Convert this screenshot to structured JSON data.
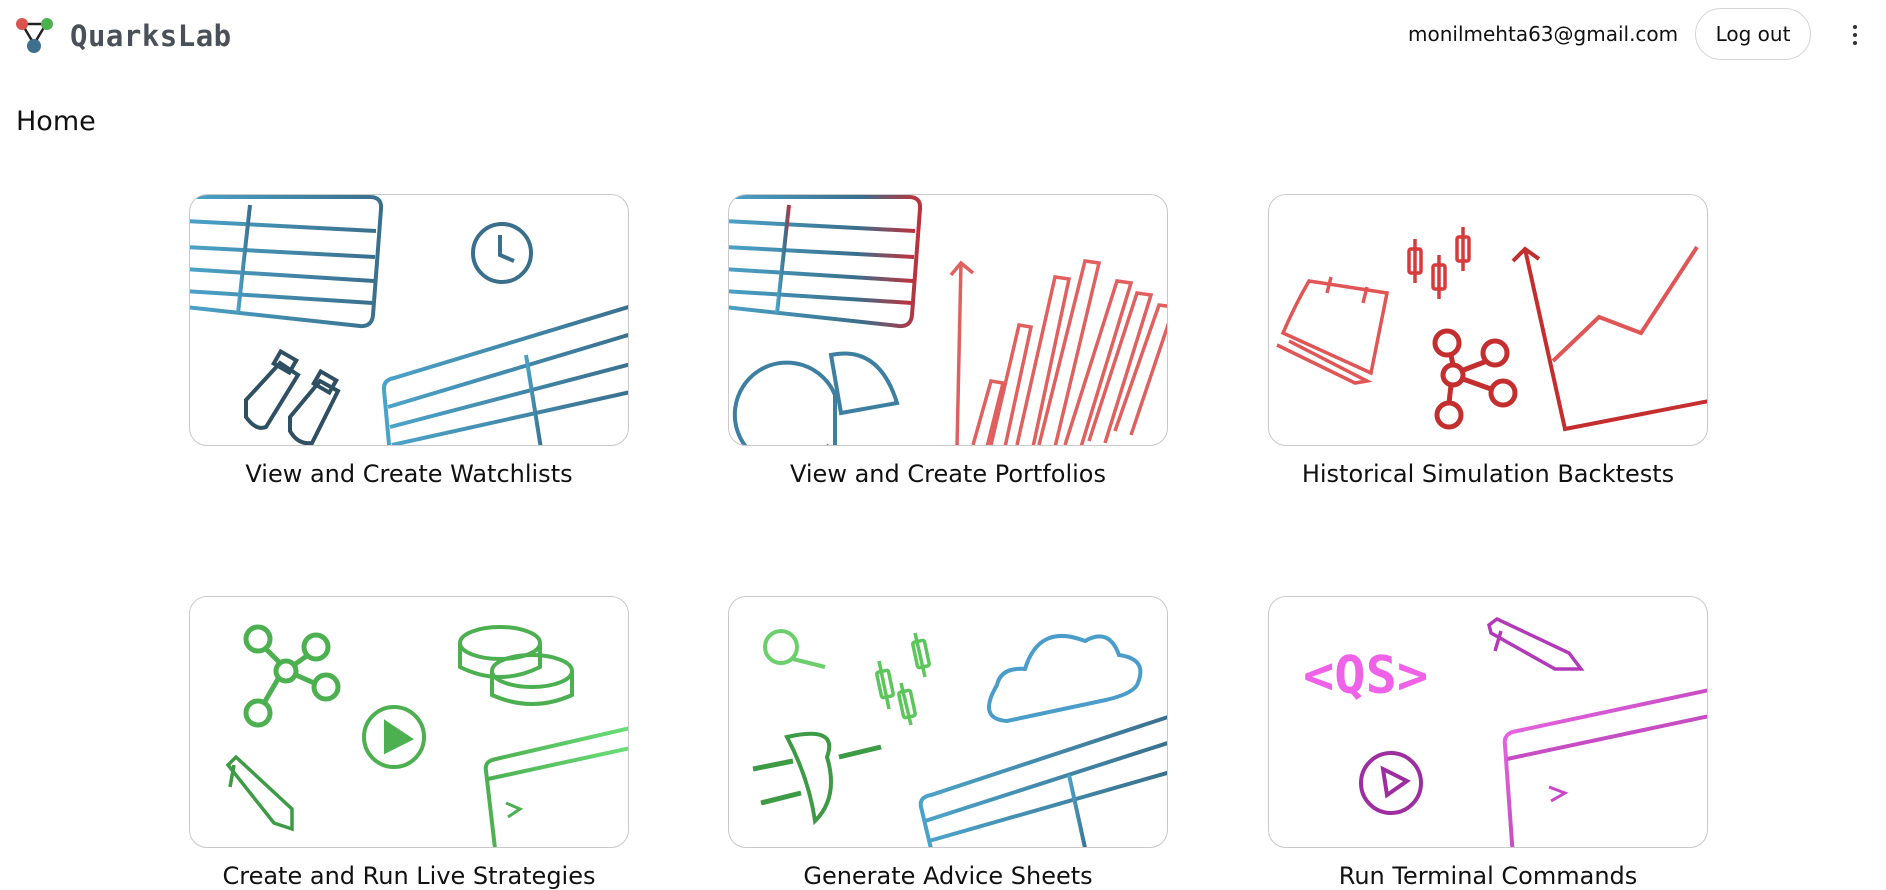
{
  "header": {
    "logo_text": "QuarksLab",
    "user_email": "monilmehta63@gmail.com",
    "logout_label": "Log out"
  },
  "page": {
    "title": "Home"
  },
  "cards": [
    {
      "label": "View and Create Watchlists",
      "icons": [
        "table-icon",
        "clock-icon",
        "binoculars-icon",
        "table-icon"
      ],
      "accent": "#3d7fa0"
    },
    {
      "label": "View and Create Portfolios",
      "icons": [
        "table-icon",
        "pie-chart-icon",
        "bar-chart-icon"
      ],
      "accent": "#d9534f"
    },
    {
      "label": "Historical Simulation Backtests",
      "icons": [
        "calendar-icon",
        "candlestick-icon",
        "network-icon",
        "line-chart-icon"
      ],
      "accent": "#d63a3a"
    },
    {
      "label": "Create and Run Live Strategies",
      "icons": [
        "network-icon",
        "coins-icon",
        "play-icon",
        "pen-icon",
        "terminal-window-icon"
      ],
      "accent": "#4caf50"
    },
    {
      "label": "Generate Advice Sheets",
      "icons": [
        "magnifier-icon",
        "candlestick-icon",
        "cloud-icon",
        "plug-icon",
        "table-icon"
      ],
      "accent": "#4a9cc9"
    },
    {
      "label": "Run Terminal Commands",
      "icons": [
        "qs-code-icon",
        "pen-icon",
        "play-icon",
        "terminal-window-icon"
      ],
      "accent": "#d74bd6"
    }
  ]
}
